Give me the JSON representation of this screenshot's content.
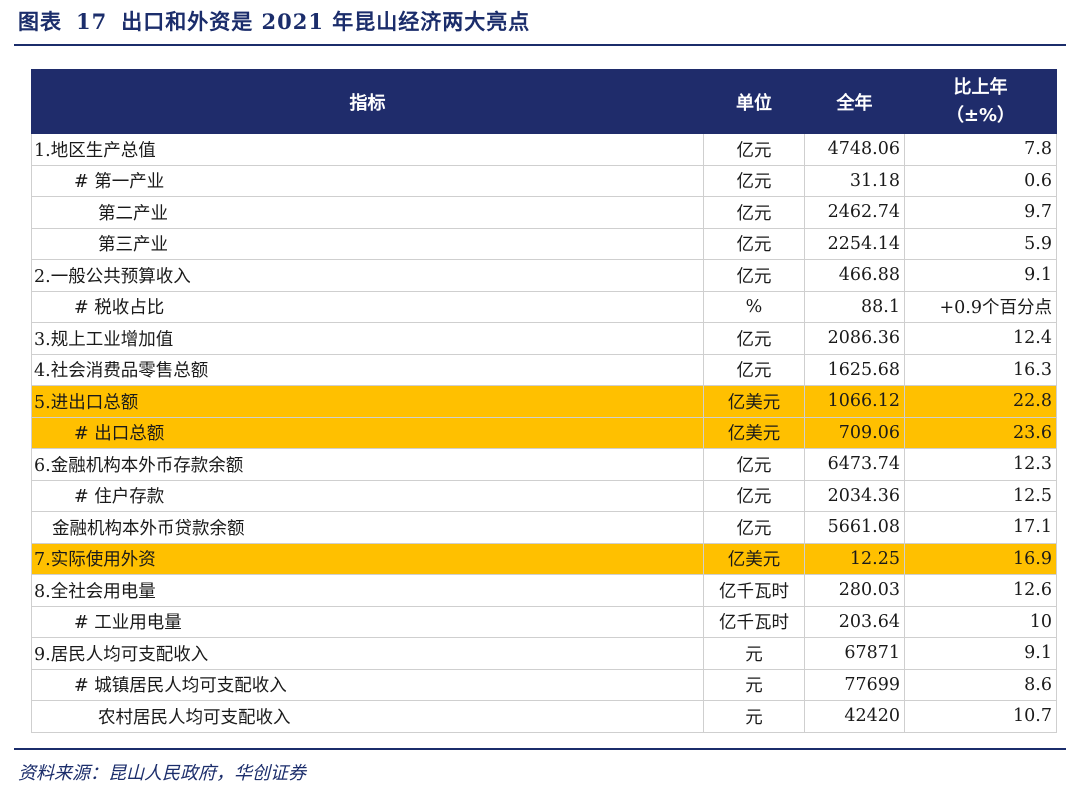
{
  "title": {
    "label": "图表",
    "number": "17",
    "text": "出口和外资是 2021 年昆山经济两大亮点"
  },
  "table": {
    "headers": {
      "indicator": "指标",
      "unit": "单位",
      "year": "全年",
      "change_line1": "比上年",
      "change_line2": "（±%）"
    },
    "rows": [
      {
        "name": "1.地区生产总值",
        "unit": "亿元",
        "value": "4748.06",
        "change": "7.8"
      },
      {
        "name": "# 第一产业",
        "unit": "亿元",
        "value": "31.18",
        "change": "0.6"
      },
      {
        "name": "第二产业",
        "unit": "亿元",
        "value": "2462.74",
        "change": "9.7"
      },
      {
        "name": "第三产业",
        "unit": "亿元",
        "value": "2254.14",
        "change": "5.9"
      },
      {
        "name": "2.一般公共预算收入",
        "unit": "亿元",
        "value": "466.88",
        "change": "9.1"
      },
      {
        "name": "# 税收占比",
        "unit": "%",
        "value": "88.1",
        "change": "+0.9个百分点"
      },
      {
        "name": "3.规上工业增加值",
        "unit": "亿元",
        "value": "2086.36",
        "change": "12.4"
      },
      {
        "name": "4.社会消费品零售总额",
        "unit": "亿元",
        "value": "1625.68",
        "change": "16.3"
      },
      {
        "name": "5.进出口总额",
        "unit": "亿美元",
        "value": "1066.12",
        "change": "22.8"
      },
      {
        "name": "# 出口总额",
        "unit": "亿美元",
        "value": "709.06",
        "change": "23.6"
      },
      {
        "name": "6.金融机构本外币存款余额",
        "unit": "亿元",
        "value": "6473.74",
        "change": "12.3"
      },
      {
        "name": "# 住户存款",
        "unit": "亿元",
        "value": "2034.36",
        "change": "12.5"
      },
      {
        "name": "金融机构本外币贷款余额",
        "unit": "亿元",
        "value": "5661.08",
        "change": "17.1"
      },
      {
        "name": "7.实际使用外资",
        "unit": "亿美元",
        "value": "12.25",
        "change": "16.9"
      },
      {
        "name": "8.全社会用电量",
        "unit": "亿千瓦时",
        "value": "280.03",
        "change": "12.6"
      },
      {
        "name": "# 工业用电量",
        "unit": "亿千瓦时",
        "value": "203.64",
        "change": "10"
      },
      {
        "name": "9.居民人均可支配收入",
        "unit": "元",
        "value": "67871",
        "change": "9.1"
      },
      {
        "name": "# 城镇居民人均可支配收入",
        "unit": "元",
        "value": "77699",
        "change": "8.6"
      },
      {
        "name": "农村居民人均可支配收入",
        "unit": "元",
        "value": "42420",
        "change": "10.7"
      }
    ]
  },
  "colors": {
    "header_bg": "#1f2c6b",
    "highlight": "#ffc000",
    "title": "#1b2d6b"
  },
  "source": "资料来源：昆山人民政府，华创证券"
}
